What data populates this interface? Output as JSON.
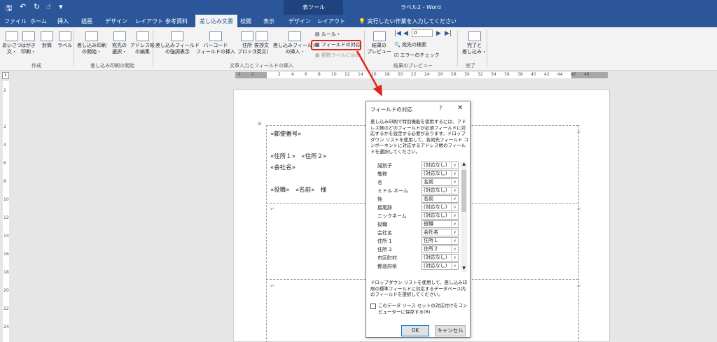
{
  "window": {
    "title": "ラベル2 - Word",
    "context_tab_group": "表ツール"
  },
  "tabs": [
    "ファイル",
    "ホーム",
    "挿入",
    "描画",
    "デザイン",
    "レイアウト",
    "参考資料",
    "差し込み文書",
    "校閲",
    "表示",
    "デザイン",
    "レイアウト"
  ],
  "active_tab": "差し込み文書",
  "tell_me": "実行したい作業を入力してください",
  "ribbon": {
    "create": {
      "envelope": "あいさつ\n文・",
      "postcard": "はがき\n印刷・",
      "envelopes": "封筒",
      "labels": "ラベル",
      "group": "作成"
    },
    "start": {
      "start_merge": "差し込み印刷\nの開始・",
      "select_recipients": "宛先の\n選択・",
      "edit_list": "アドレス帳\nの編集",
      "group": "差し込み印刷の開始"
    },
    "write": {
      "highlight_fields": "差し込みフィールド\nの強調表示",
      "address_block": "住所\nブロック",
      "greeting": "挨拶文\n(英文)",
      "insert_field": "差し込みフィールド\nの挿入・",
      "barcode": "バーコード\nフィールドの挿入",
      "rules": "ルール・",
      "match_fields": "フィールドの対応",
      "update_labels": "複数ラベルに反映",
      "group": "文章入力とフィールドの挿入"
    },
    "preview": {
      "preview_results": "結果の\nプレビュー",
      "record": "0",
      "find_recipient": "宛先の検索",
      "check_errors": "エラーのチェック",
      "group": "結果のプレビュー"
    },
    "finish": {
      "finish_merge": "完了と\n差し込み・",
      "group": "完了"
    }
  },
  "ruler_marks": [
    "4",
    "2",
    "",
    "2",
    "4",
    "6",
    "8",
    "10",
    "12",
    "14",
    "16",
    "18",
    "20",
    "22",
    "24",
    "26",
    "28",
    "30",
    "32",
    "34",
    "36",
    "38",
    "40",
    "42",
    "44",
    "46",
    "48"
  ],
  "vruler_marks": [
    "2",
    "",
    "2",
    "4",
    "6",
    "8",
    "10",
    "12",
    "14",
    "16",
    "18",
    "20",
    "22",
    "24"
  ],
  "document": {
    "postal": "«郵便番号»",
    "address": "«住所１»　«住所２»",
    "company": "«会社名»",
    "title_name": "«役職»　«名前»　様"
  },
  "dialog": {
    "title": "フィールドの対応",
    "help": "?",
    "close": "✕",
    "description": "差し込み印刷で特別機能を使用するには、アドレス帳のどのフィールドが必須フィールドに対応するかを設定する必要があります。ドロップダウン リストを使用して、各宛先フィールド コンポーネントに対応するアドレス帳のフィールドを選択してください。",
    "fields": [
      {
        "label": "識別子",
        "value": "(対応なし)"
      },
      {
        "label": "敬称",
        "value": "(対応なし)"
      },
      {
        "label": "名",
        "value": "名前"
      },
      {
        "label": "ミドル ネーム",
        "value": "(対応なし)"
      },
      {
        "label": "姓",
        "value": "名前"
      },
      {
        "label": "接尾辞",
        "value": "(対応なし)"
      },
      {
        "label": "ニックネーム",
        "value": "(対応なし)"
      },
      {
        "label": "役職",
        "value": "役職"
      },
      {
        "label": "会社名",
        "value": "会社名"
      },
      {
        "label": "住所 1",
        "value": "住所１"
      },
      {
        "label": "住所 2",
        "value": "住所２"
      },
      {
        "label": "市区町村",
        "value": "(対応なし)"
      },
      {
        "label": "都道府県",
        "value": "(対応なし)"
      }
    ],
    "footer": "ドロップダウン リストを使用して、差し込み印刷の標準フィールドに対応するデータベース内のフィールドを選択してください。",
    "remember": "このデータ ソース セットの対応付けをコンピューターに保存する(R)",
    "ok": "OK",
    "cancel": "キャンセル"
  },
  "colors": {
    "brand": "#2b579a",
    "highlight": "#e0241b"
  }
}
